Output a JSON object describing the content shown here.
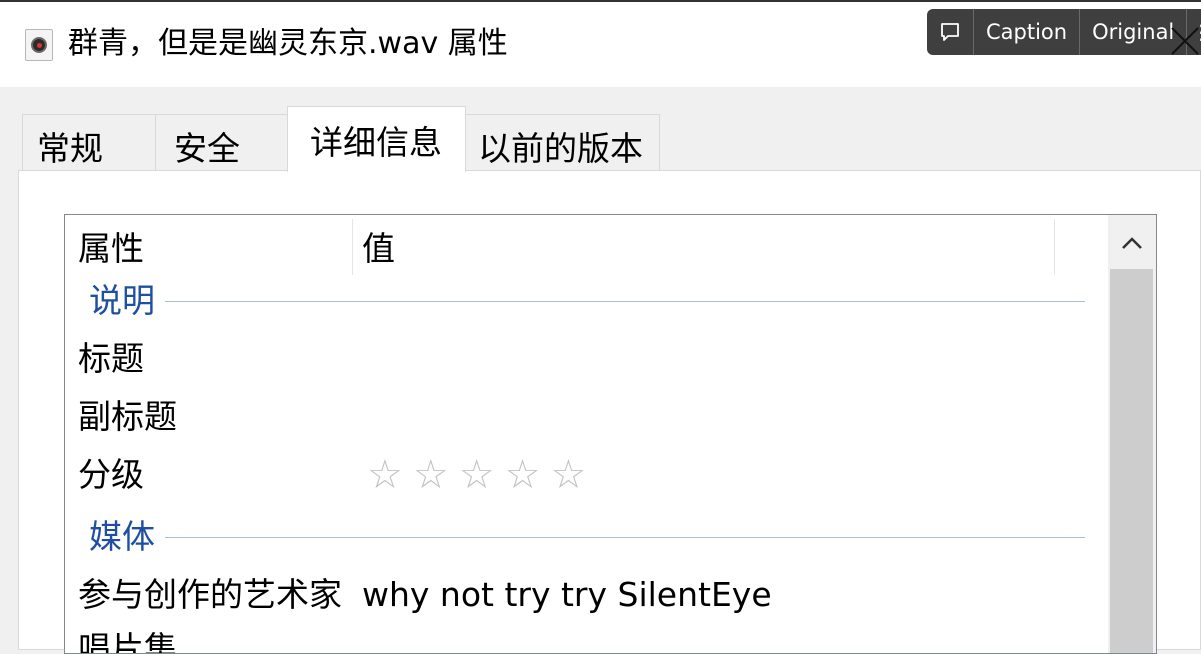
{
  "window": {
    "title": "群青，但是是幽灵东京.wav 属性",
    "file_icon": "audio-file-icon"
  },
  "overlay": {
    "chat_icon": "comment-icon",
    "caption_label": "Caption",
    "original_label": "Original",
    "more_label": "⋮",
    "close_icon": "close-icon"
  },
  "tabs": [
    {
      "label": "常规",
      "active": false
    },
    {
      "label": "安全",
      "active": false
    },
    {
      "label": "详细信息",
      "active": true
    },
    {
      "label": "以前的版本",
      "active": false
    }
  ],
  "details": {
    "header_property": "属性",
    "header_value": "值",
    "groups": [
      {
        "label": "说明",
        "rows": [
          {
            "label": "标题",
            "value": ""
          },
          {
            "label": "副标题",
            "value": ""
          },
          {
            "label": "分级",
            "rating": 0,
            "max_rating": 5,
            "value": ""
          }
        ]
      },
      {
        "label": "媒体",
        "rows": [
          {
            "label": "参与创作的艺术家",
            "value": "why not try try SilentEye"
          },
          {
            "label": "唱片集",
            "value": ""
          }
        ]
      }
    ]
  },
  "colors": {
    "group_text": "#1e4fa3",
    "group_line": "#a9bde3",
    "star": "#c3c3c3",
    "overlay_bg": "#3f3f3f"
  }
}
